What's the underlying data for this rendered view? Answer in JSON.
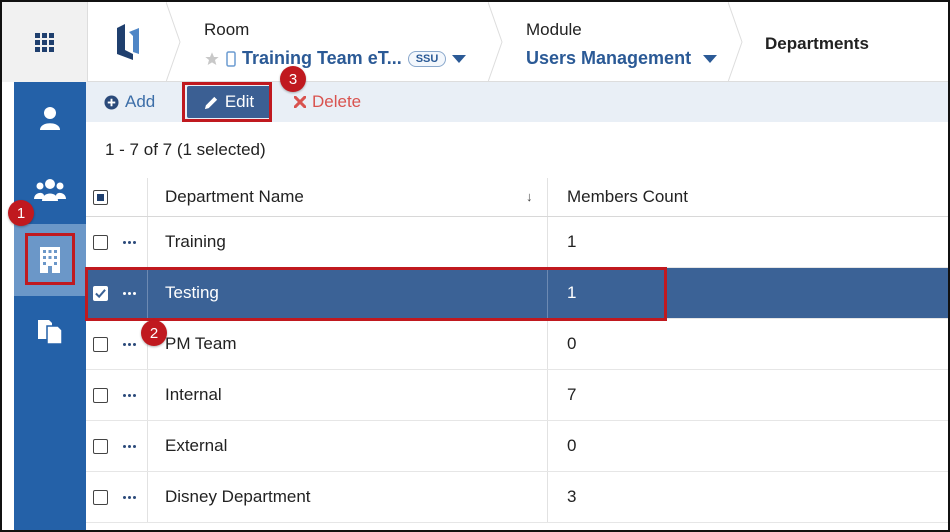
{
  "breadcrumb": {
    "room": {
      "title": "Room",
      "value": "Training Team eT...",
      "badge": "SSU"
    },
    "module": {
      "title": "Module",
      "value": "Users Management"
    },
    "current": "Departments"
  },
  "toolbar": {
    "add_label": "Add",
    "edit_label": "Edit",
    "delete_label": "Delete"
  },
  "result_count": "1 - 7 of 7 (1 selected)",
  "table": {
    "columns": [
      "Department Name",
      "Members Count"
    ],
    "rows": [
      {
        "name": "Training",
        "count": "1",
        "selected": false
      },
      {
        "name": "Testing",
        "count": "1",
        "selected": true
      },
      {
        "name": "PM Team",
        "count": "0",
        "selected": false
      },
      {
        "name": "Internal",
        "count": "7",
        "selected": false
      },
      {
        "name": "External",
        "count": "0",
        "selected": false
      },
      {
        "name": "Disney Department",
        "count": "3",
        "selected": false
      }
    ]
  },
  "callouts": [
    "1",
    "2",
    "3"
  ],
  "colors": {
    "accent": "#2461a8",
    "selected_row": "#3b6296",
    "highlight": "#c0191f",
    "delete": "#d9534f"
  }
}
